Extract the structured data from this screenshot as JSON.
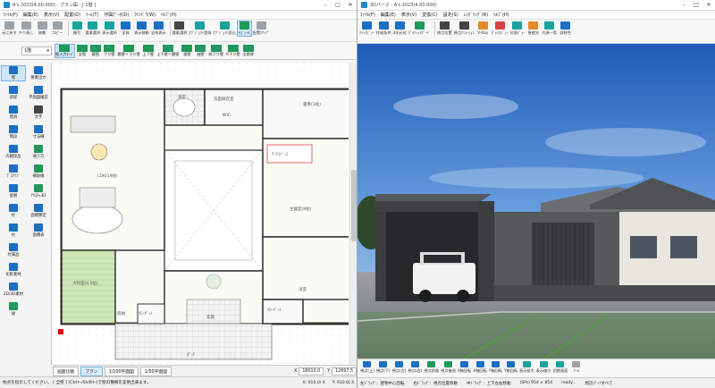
{
  "left": {
    "title": "A's 2023(4.00.000) - プラン図 - [ 1階 ]",
    "menu": [
      "ﾌｧｲﾙ(F)",
      "編集(E)",
      "表示(V)",
      "配置(D)",
      "ﾂｰﾙ(T)",
      "作図ﾃﾞｰﾀ(D)",
      "ｳｲﾝﾄﾞｳ(W)",
      "ﾍﾙﾌﾟ(H)"
    ],
    "toolbar": [
      "元に戻す",
      "やり直し",
      "移動",
      "コピー",
      "複写",
      "要素選択",
      "表示選択",
      "全体",
      "表示移動",
      "全体表示",
      "要素選択",
      "ｵﾌﾞｼﾞｪｸﾄ登録",
      "ｵﾌﾞｼﾞｪｸﾄ読込",
      "ﾓｼﾞｭｰﾙ",
      "配置ｽﾅｯﾌﾟ"
    ],
    "floor": "1階",
    "wall_tools": [
      "壁入力ﾓｰﾄﾞ",
      "全壁",
      "腰壁",
      "下り壁",
      "腰壁＋下り壁",
      "上下壁",
      "上下壁＋腰壁",
      "垂壁",
      "袖壁",
      "斜下り壁",
      "R下り壁",
      "全削除"
    ],
    "sidebar": [
      {
        "label": "壁",
        "icon": "wall-icon"
      },
      {
        "label": "要素出力",
        "icon": "export-icon"
      },
      {
        "label": "部屋",
        "icon": "room-icon"
      },
      {
        "label": "平面図確認",
        "icon": "plan-check-icon"
      },
      {
        "label": "建具",
        "icon": "door-icon"
      },
      {
        "label": "文字",
        "icon": "text-icon"
      },
      {
        "label": "階段",
        "icon": "stairs-icon"
      },
      {
        "label": "寸法線",
        "icon": "dimension-icon"
      },
      {
        "label": "内観部品",
        "icon": "interior-icon"
      },
      {
        "label": "通り芯",
        "icon": "grid-line-icon"
      },
      {
        "label": "ﾃﾞｽｸﾗﾌﾞ",
        "icon": "desk-icon"
      },
      {
        "label": "補助線",
        "icon": "guide-line-icon"
      },
      {
        "label": "屋根",
        "icon": "roof-icon"
      },
      {
        "label": "ﾃｸｽﾁｬ3D",
        "icon": "texture-icon"
      },
      {
        "label": "柱",
        "icon": "column-icon"
      },
      {
        "label": "面積算定",
        "icon": "area-icon"
      },
      {
        "label": "柱",
        "icon": "pillar-icon"
      },
      {
        "label": "面積表",
        "icon": "area-table-icon"
      },
      {
        "label": "付属品",
        "icon": "accessory-icon"
      },
      {
        "label": "化粧素材",
        "icon": "material-icon"
      },
      {
        "label": "2D/3D素材",
        "icon": "asset-icon"
      },
      {
        "label": "緑",
        "icon": "green-icon"
      }
    ],
    "rooms": [
      "浴室",
      "洗面脱衣室",
      "LDK(14帖)",
      "書斎(1帖)",
      "ﾜｰｸｽﾍﾟｰｽ",
      "主寝室(8帖)",
      "大和室(4.5帖)",
      "洋室",
      "玄関",
      "ｸﾛｰｾﾞｯﾄ",
      "ﾎﾟｰﾁ",
      "ｸﾛｰｾﾞｯﾄ",
      "収納",
      "WIC"
    ],
    "bottom_tabs": [
      "画面切替",
      "プラン",
      "1/100平面図",
      "1/50平面図"
    ],
    "coords": {
      "x_label": "X",
      "x": "18010.0",
      "y_label": "Y",
      "y": "12697.5"
    },
    "status": {
      "message": "始点を指示してください。 [ 全壁 ] [Ctrlｷｰ/Shiftｷｰ]で壁の種類を変更出来ます。",
      "x": "X: 910.0/ 4",
      "y": "Y: 910.0/ 4"
    }
  },
  "right": {
    "title": "3Dパース - A's 2023(4.00.000)",
    "menu": [
      "ﾌｧｲﾙ(F)",
      "編集(E)",
      "表示(V)",
      "変換(C)",
      "設定(S)",
      "ﾚﾝﾀﾞﾘﾝｸﾞ(R)",
      "ﾍﾙﾌﾟ(H)"
    ],
    "toolbar": [
      "ｸｲｯｸﾋﾞｭｰ",
      "作成条件",
      "3次元化",
      "ｸﾞﾗﾌｨｯｸﾎﾞｰﾄﾞ",
      "視点位置",
      "視点ｱﾆﾒｰｼｮﾝ",
      "V-Ray",
      "ﾎﾞｯｸｽﾋﾞｭｰ",
      "対面ﾋﾞｭｰ",
      "昼夜光",
      "光源一覧",
      "部材色"
    ],
    "nav": [
      "視点(上)",
      "視点(下)",
      "視点(左)",
      "視点(右)",
      "視点前進",
      "視点後退",
      "X軸回転",
      "X軸回転",
      "Y軸回転",
      "Y軸回転",
      "表示拡大",
      "表示縮小",
      "初期画面",
      "ﾂｰﾙ"
    ],
    "status": [
      "左ﾄﾞﾗｯｸﾞ：建物中心回転",
      "右ﾄﾞﾗｯｸﾞ：視点位置移動",
      "中ﾄﾞﾗｯｸﾞ：上下左右移動",
      "(SPs) 954 × 854",
      "ready...",
      "周辺ﾊﾟｰﾂすべて"
    ]
  }
}
